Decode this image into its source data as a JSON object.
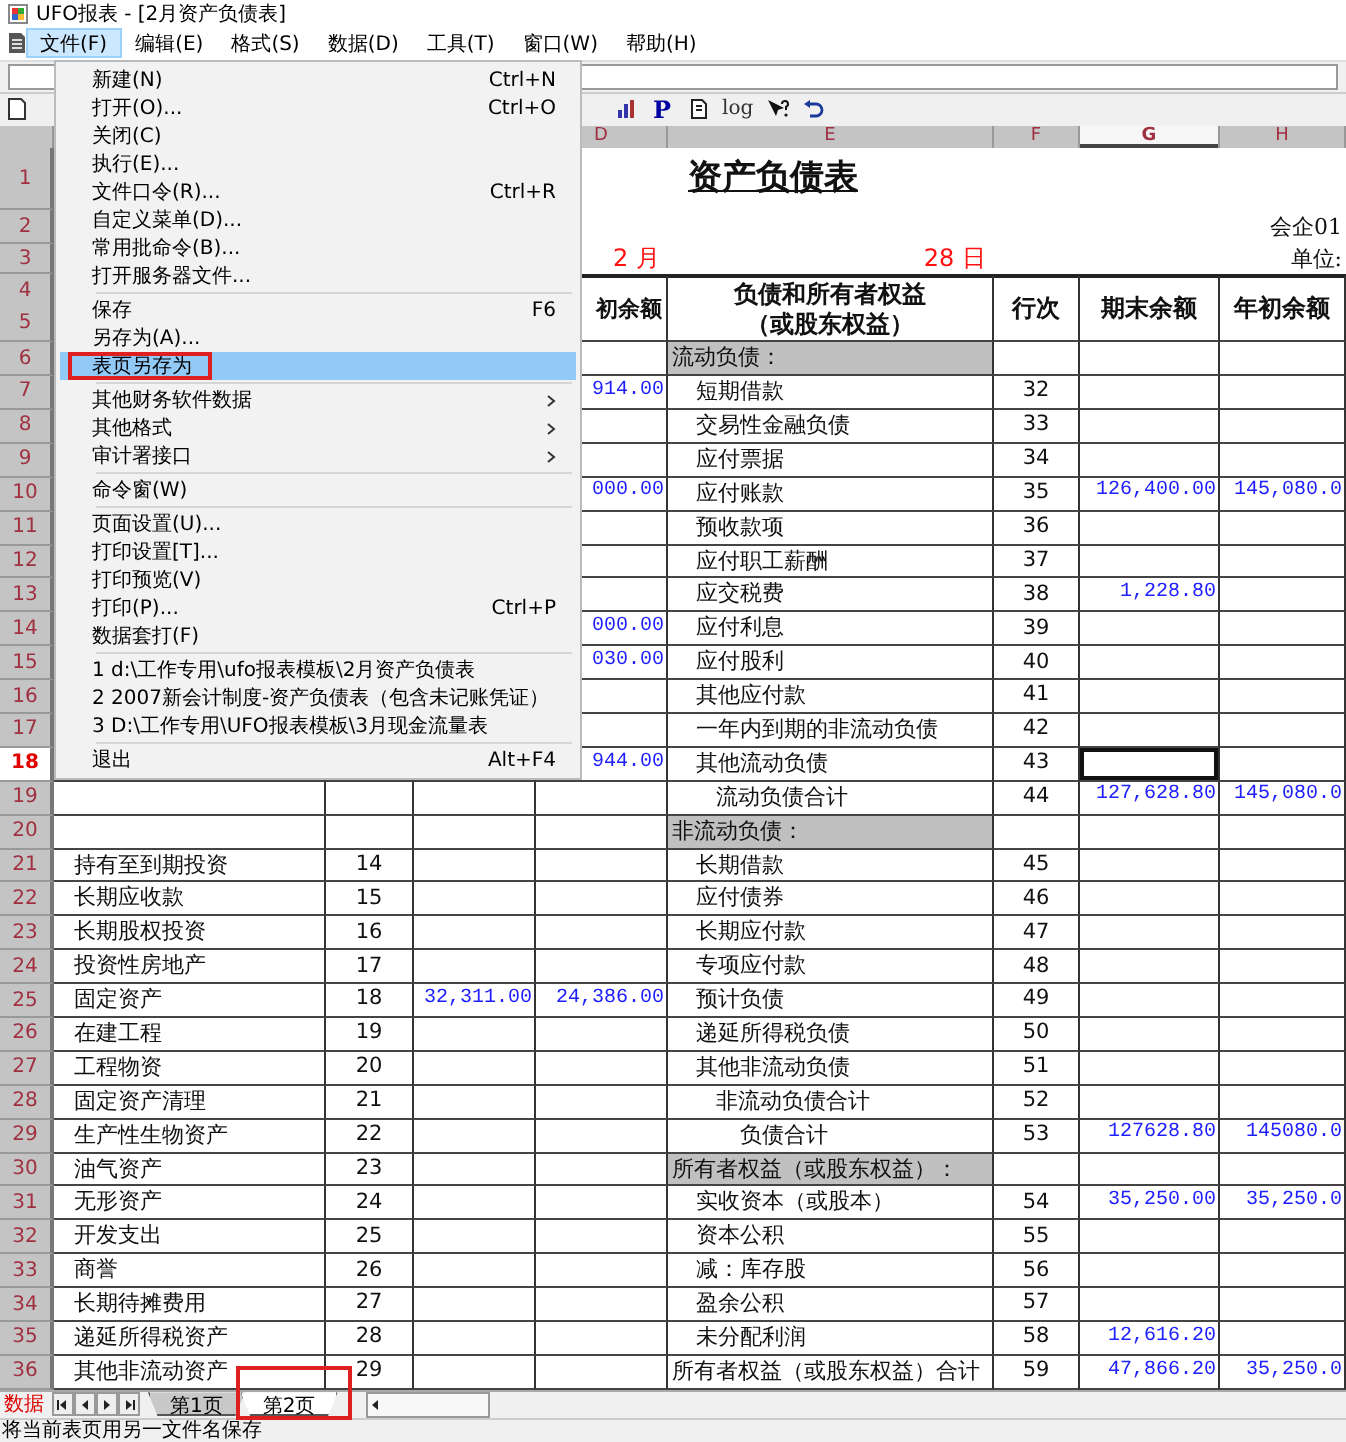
{
  "window": {
    "title": "UFO报表 - [2月资产负债表]"
  },
  "menubar": [
    {
      "label": "文件(F)",
      "selected": true
    },
    {
      "label": "编辑(E)",
      "selected": false
    },
    {
      "label": "格式(S)",
      "selected": false
    },
    {
      "label": "数据(D)",
      "selected": false
    },
    {
      "label": "工具(T)",
      "selected": false
    },
    {
      "label": "窗口(W)",
      "selected": false
    },
    {
      "label": "帮助(H)",
      "selected": false
    }
  ],
  "toolbar": [
    {
      "kind": "chart"
    },
    {
      "kind": "text",
      "label": "P"
    },
    {
      "kind": "pointer"
    },
    {
      "kind": "text",
      "label": "log"
    },
    {
      "kind": "help"
    },
    {
      "kind": "undo"
    }
  ],
  "columns": [
    {
      "label": "D",
      "selected": false
    },
    {
      "label": "E",
      "selected": false
    },
    {
      "label": "F",
      "selected": false
    },
    {
      "label": "G",
      "selected": true
    },
    {
      "label": "H",
      "selected": false
    }
  ],
  "rows": [
    {
      "kind": "title",
      "number": "1",
      "selected": false,
      "cells": {
        "E": "资产负债表"
      }
    },
    {
      "kind": "note",
      "number": "2",
      "selected": false,
      "cells": {
        "H": "会企01"
      }
    },
    {
      "kind": "date",
      "number": "3",
      "selected": false,
      "cells": {
        "D": "2 月",
        "E": "28 日",
        "H": "单位:"
      }
    },
    {
      "kind": "header",
      "numbers": [
        "4",
        "5"
      ],
      "selected": false,
      "cells": {
        "D": "初余额",
        "E": [
          "负债和所有者权益",
          "（或股东权益）"
        ],
        "F": "行次",
        "G": "期末余额",
        "H": "年初余额"
      }
    },
    {
      "kind": "section",
      "number": "6",
      "selected": false,
      "cells": {
        "E": "流动负债："
      }
    },
    {
      "kind": "item",
      "number": "7",
      "selected": false,
      "cells": {
        "D": "914.00",
        "E": "短期借款",
        "F": "32"
      }
    },
    {
      "kind": "item",
      "number": "8",
      "selected": false,
      "cells": {
        "E": "交易性金融负债",
        "F": "33"
      }
    },
    {
      "kind": "item",
      "number": "9",
      "selected": false,
      "cells": {
        "E": "应付票据",
        "F": "34"
      }
    },
    {
      "kind": "item",
      "number": "10",
      "selected": false,
      "cells": {
        "D": "000.00",
        "E": "应付账款",
        "F": "35",
        "G": "126,400.00",
        "H": "145,080.0"
      }
    },
    {
      "kind": "item",
      "number": "11",
      "selected": false,
      "cells": {
        "E": "预收款项",
        "F": "36"
      }
    },
    {
      "kind": "item",
      "number": "12",
      "selected": false,
      "cells": {
        "E": "应付职工薪酬",
        "F": "37"
      }
    },
    {
      "kind": "item",
      "number": "13",
      "selected": false,
      "cells": {
        "E": "应交税费",
        "F": "38",
        "G": "1,228.80"
      }
    },
    {
      "kind": "item",
      "number": "14",
      "selected": false,
      "cells": {
        "D": "000.00",
        "E": "应付利息",
        "F": "39"
      }
    },
    {
      "kind": "item",
      "number": "15",
      "selected": false,
      "cells": {
        "D": "030.00",
        "E": "应付股利",
        "F": "40"
      }
    },
    {
      "kind": "item",
      "number": "16",
      "selected": false,
      "cells": {
        "E": "其他应付款",
        "F": "41"
      }
    },
    {
      "kind": "item",
      "number": "17",
      "selected": false,
      "cells": {
        "E": "一年内到期的非流动负债",
        "F": "42"
      }
    },
    {
      "kind": "item",
      "number": "18",
      "selected": true,
      "cells": {
        "D": "944.00",
        "E": "其他流动负债",
        "F": "43"
      }
    },
    {
      "kind": "subtotal",
      "number": "19",
      "selected": false,
      "cells": {
        "E": "流动负债合计",
        "F": "44",
        "G": "127,628.80",
        "H": "145,080.0"
      }
    },
    {
      "kind": "section",
      "number": "20",
      "selected": false,
      "cells": {
        "E": "非流动负债："
      }
    },
    {
      "kind": "item",
      "number": "21",
      "selected": false,
      "cells": {
        "A": "持有至到期投资",
        "B": "14",
        "E": "长期借款",
        "F": "45"
      }
    },
    {
      "kind": "item",
      "number": "22",
      "selected": false,
      "cells": {
        "A": "长期应收款",
        "B": "15",
        "E": "应付债券",
        "F": "46"
      }
    },
    {
      "kind": "item",
      "number": "23",
      "selected": false,
      "cells": {
        "A": "长期股权投资",
        "B": "16",
        "E": "长期应付款",
        "F": "47"
      }
    },
    {
      "kind": "item",
      "number": "24",
      "selected": false,
      "cells": {
        "A": "投资性房地产",
        "B": "17",
        "E": "专项应付款",
        "F": "48"
      }
    },
    {
      "kind": "item",
      "number": "25",
      "selected": false,
      "cells": {
        "A": "固定资产",
        "B": "18",
        "C": "32,311.00",
        "D": "24,386.00",
        "E": "预计负债",
        "F": "49"
      }
    },
    {
      "kind": "item",
      "number": "26",
      "selected": false,
      "cells": {
        "A": "在建工程",
        "B": "19",
        "E": "递延所得税负债",
        "F": "50"
      }
    },
    {
      "kind": "item",
      "number": "27",
      "selected": false,
      "cells": {
        "A": "工程物资",
        "B": "20",
        "E": "其他非流动负债",
        "F": "51"
      }
    },
    {
      "kind": "subtotal",
      "number": "28",
      "selected": false,
      "cells": {
        "A": "固定资产清理",
        "B": "21",
        "E": "非流动负债合计",
        "F": "52"
      }
    },
    {
      "kind": "total",
      "number": "29",
      "selected": false,
      "cells": {
        "A": "生产性生物资产",
        "B": "22",
        "E": "负债合计",
        "F": "53",
        "G": "127628.80",
        "H": "145080.0"
      }
    },
    {
      "kind": "section",
      "number": "30",
      "selected": false,
      "cells": {
        "A": "油气资产",
        "B": "23",
        "E": "所有者权益（或股东权益）："
      }
    },
    {
      "kind": "item",
      "number": "31",
      "selected": false,
      "cells": {
        "A": "无形资产",
        "B": "24",
        "E": "实收资本（或股本）",
        "F": "54",
        "G": "35,250.00",
        "H": "35,250.0"
      }
    },
    {
      "kind": "item",
      "number": "32",
      "selected": false,
      "cells": {
        "A": "开发支出",
        "B": "25",
        "E": "资本公积",
        "F": "55"
      }
    },
    {
      "kind": "item",
      "number": "33",
      "selected": false,
      "cells": {
        "A": "商誉",
        "B": "26",
        "E": "减：库存股",
        "F": "56"
      }
    },
    {
      "kind": "item",
      "number": "34",
      "selected": false,
      "cells": {
        "A": "长期待摊费用",
        "B": "27",
        "E": "盈余公积",
        "F": "57"
      }
    },
    {
      "kind": "item",
      "number": "35",
      "selected": false,
      "cells": {
        "A": "递延所得税资产",
        "B": "28",
        "E": "未分配利润",
        "F": "58",
        "G": "12,616.20"
      }
    },
    {
      "kind": "grand_total",
      "number": "36",
      "selected": false,
      "cells": {
        "A": "其他非流动资产",
        "B": "29",
        "E": "所有者权益（或股东权益）合计",
        "F": "59",
        "G": "47,866.20",
        "H": "35,250.0"
      }
    }
  ],
  "file_menu": [
    {
      "kind": "item",
      "label": "新建(N)",
      "shortcut": "Ctrl+N",
      "submenu": false,
      "highlighted": false,
      "annotated": false
    },
    {
      "kind": "item",
      "label": "打开(O)...",
      "shortcut": "Ctrl+O",
      "submenu": false,
      "highlighted": false,
      "annotated": false
    },
    {
      "kind": "item",
      "label": "关闭(C)",
      "submenu": false,
      "highlighted": false,
      "annotated": false
    },
    {
      "kind": "item",
      "label": "执行(E)...",
      "submenu": false,
      "highlighted": false,
      "annotated": false
    },
    {
      "kind": "item",
      "label": "文件口令(R)...",
      "shortcut": "Ctrl+R",
      "submenu": false,
      "highlighted": false,
      "annotated": false
    },
    {
      "kind": "item",
      "label": "自定义菜单(D)...",
      "submenu": false,
      "highlighted": false,
      "annotated": false
    },
    {
      "kind": "item",
      "label": "常用批命令(B)...",
      "submenu": false,
      "highlighted": false,
      "annotated": false
    },
    {
      "kind": "item",
      "label": "打开服务器文件...",
      "submenu": false,
      "highlighted": false,
      "annotated": false
    },
    {
      "kind": "separator"
    },
    {
      "kind": "item",
      "label": "保存",
      "shortcut": "F6",
      "submenu": false,
      "highlighted": false,
      "annotated": false
    },
    {
      "kind": "item",
      "label": "另存为(A)...",
      "submenu": false,
      "highlighted": false,
      "annotated": false
    },
    {
      "kind": "item",
      "label": "表页另存为",
      "submenu": false,
      "highlighted": true,
      "annotated": true
    },
    {
      "kind": "separator"
    },
    {
      "kind": "item",
      "label": "其他财务软件数据",
      "submenu": true,
      "highlighted": false,
      "annotated": false
    },
    {
      "kind": "item",
      "label": "其他格式",
      "submenu": true,
      "highlighted": false,
      "annotated": false
    },
    {
      "kind": "item",
      "label": "审计署接口",
      "submenu": true,
      "highlighted": false,
      "annotated": false
    },
    {
      "kind": "separator"
    },
    {
      "kind": "item",
      "label": "命令窗(W)",
      "submenu": false,
      "highlighted": false,
      "annotated": false
    },
    {
      "kind": "separator"
    },
    {
      "kind": "item",
      "label": "页面设置(U)...",
      "submenu": false,
      "highlighted": false,
      "annotated": false
    },
    {
      "kind": "item",
      "label": "打印设置[T]...",
      "submenu": false,
      "highlighted": false,
      "annotated": false
    },
    {
      "kind": "item",
      "label": "打印预览(V)",
      "submenu": false,
      "highlighted": false,
      "annotated": false
    },
    {
      "kind": "item",
      "label": "打印(P)...",
      "shortcut": "Ctrl+P",
      "submenu": false,
      "highlighted": false,
      "annotated": false
    },
    {
      "kind": "item",
      "label": "数据套打(F)",
      "submenu": false,
      "highlighted": false,
      "annotated": false
    },
    {
      "kind": "separator"
    },
    {
      "kind": "item",
      "label": "1 d:\\工作专用\\ufo报表模板\\2月资产负债表",
      "submenu": false,
      "highlighted": false,
      "annotated": false
    },
    {
      "kind": "item",
      "label": "2 2007新会计制度-资产负债表（包含未记账凭证）",
      "submenu": false,
      "highlighted": false,
      "annotated": false
    },
    {
      "kind": "item",
      "label": "3 D:\\工作专用\\UFO报表模板\\3月现金流量表",
      "submenu": false,
      "highlighted": false,
      "annotated": false
    },
    {
      "kind": "separator"
    },
    {
      "kind": "item",
      "label": "退出",
      "shortcut": "Alt+F4",
      "submenu": false,
      "highlighted": false,
      "annotated": false
    }
  ],
  "sheet_tabs": {
    "mode": "数据",
    "tabs": [
      {
        "label": "第1页",
        "selected": false,
        "annotated": false
      },
      {
        "label": "第2页",
        "selected": true,
        "annotated": true
      }
    ]
  },
  "status_bar": "将当前表页用另一文件名保存"
}
